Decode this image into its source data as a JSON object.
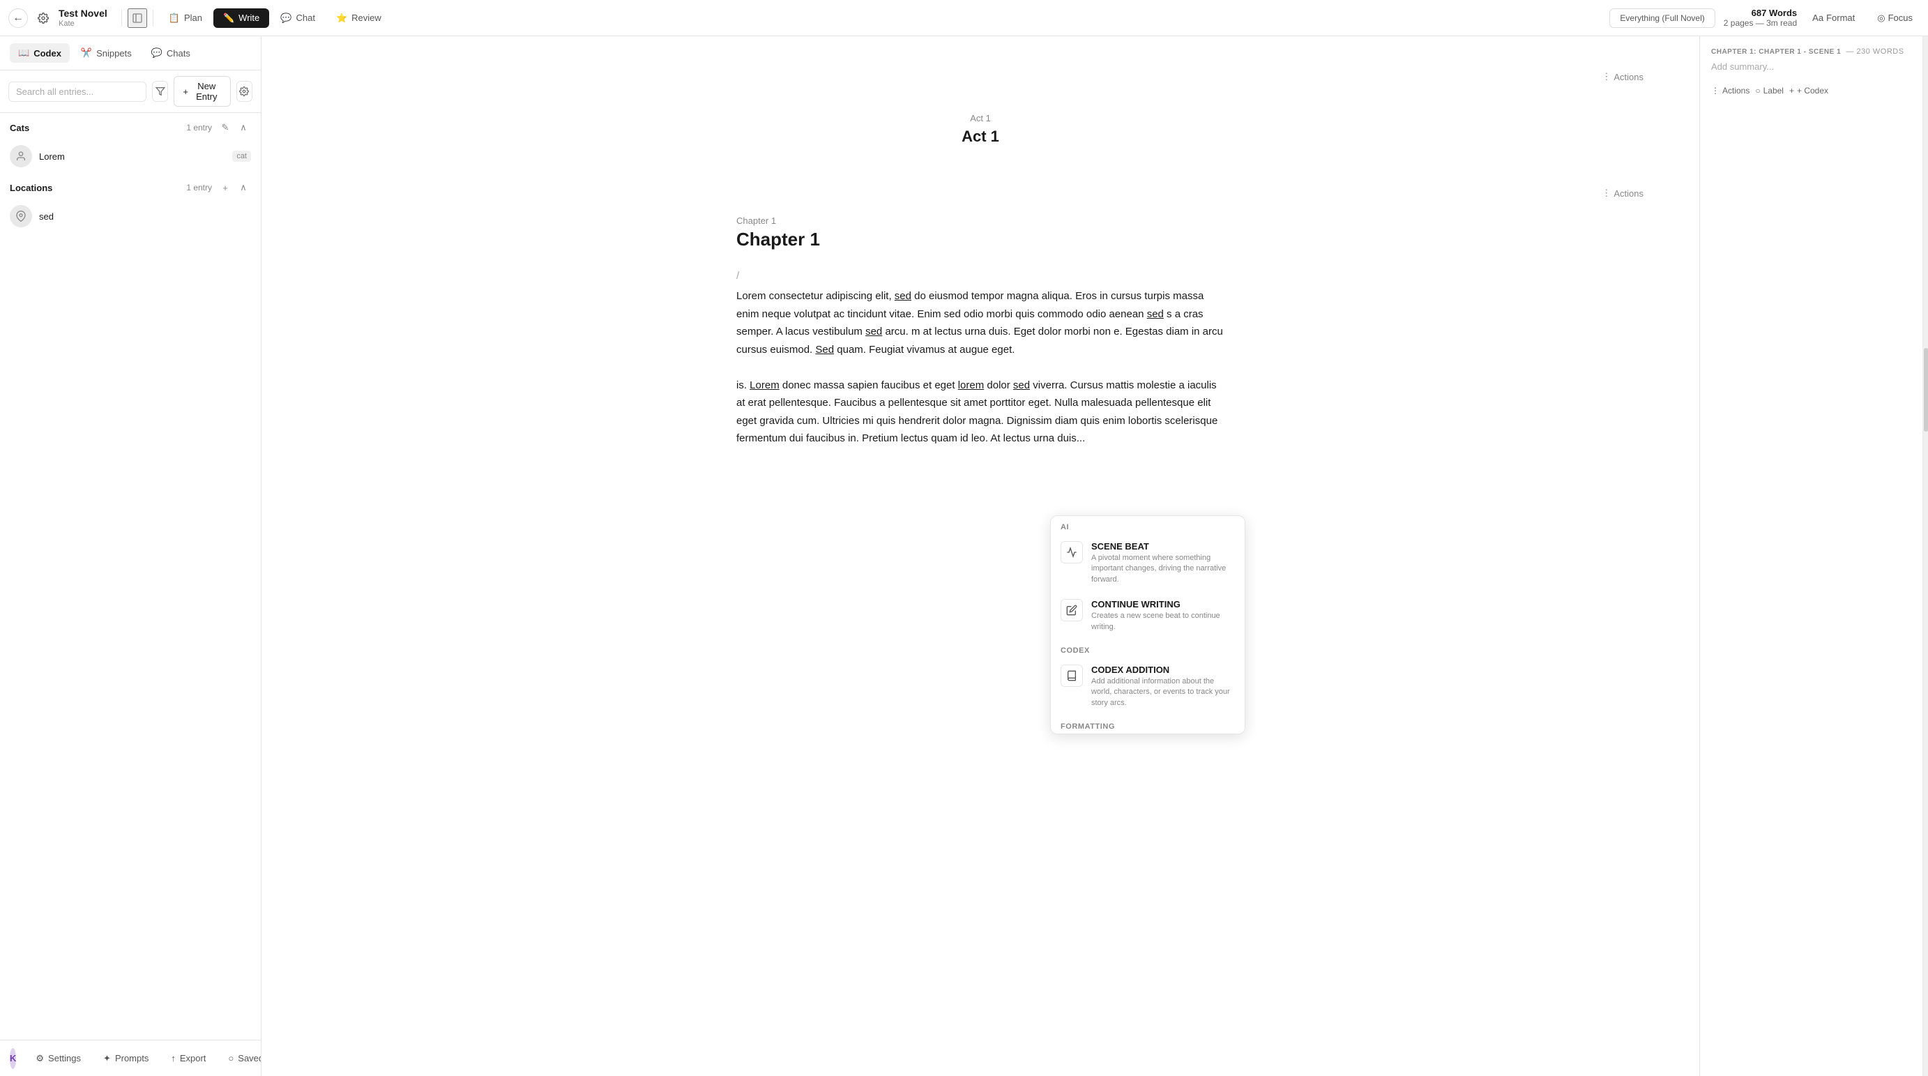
{
  "app": {
    "title": "Test Novel",
    "subtitle": "Kate",
    "back_label": "←",
    "settings_label": "⚙"
  },
  "top_nav": {
    "tabs": [
      {
        "id": "plan",
        "label": "Plan",
        "icon": "📋",
        "active": false
      },
      {
        "id": "write",
        "label": "Write",
        "icon": "✏️",
        "active": true
      },
      {
        "id": "chat",
        "label": "Chat",
        "icon": "💬",
        "active": false
      },
      {
        "id": "review",
        "label": "Review",
        "icon": "⭐",
        "active": false
      }
    ],
    "view_label": "Everything (Full Novel)",
    "word_count": "687 Words",
    "word_detail": "2 pages — 3m read",
    "format_label": "Format",
    "focus_label": "Focus"
  },
  "sidebar": {
    "tabs": [
      {
        "id": "codex",
        "label": "Codex",
        "active": true
      },
      {
        "id": "snippets",
        "label": "Snippets",
        "active": false
      },
      {
        "id": "chats",
        "label": "Chats",
        "active": false
      }
    ],
    "search_placeholder": "Search all entries...",
    "new_entry_label": "New Entry",
    "sections": [
      {
        "title": "Cats",
        "count": "1 entry",
        "items": [
          {
            "id": "lorem",
            "name": "Lorem",
            "badge": "cat",
            "type": "person"
          }
        ]
      },
      {
        "title": "Locations",
        "count": "1 entry",
        "items": [
          {
            "id": "sed",
            "name": "sed",
            "badge": "",
            "type": "location"
          }
        ]
      }
    ]
  },
  "bottom_bar": {
    "settings_label": "Settings",
    "prompts_label": "Prompts",
    "export_label": "Export",
    "saved_label": "Saved",
    "user_initials": "K"
  },
  "editor": {
    "act": {
      "label": "Act 1",
      "title": "Act 1"
    },
    "chapter": {
      "label": "Chapter 1",
      "title": "Chapter 1"
    },
    "scene_label": "CHAPTER 1: CHAPTER 1 - SCENE 1",
    "scene_word_count": "230 Words",
    "summary_placeholder": "Add summary...",
    "slash_char": "/",
    "body_text": "ctetur adipiscing elit, sed do eiusmod tempor magna aliqua. Eros in cursus turpis massa enim neque volutpat ac tincidunt vitae. Enim d odio morbi quis commodo odio aenean sed s a cras semper. A lacus vestibulum sed arcu. m at lectus urna duis. Eget dolor morbi non e. Egestas diam in arcu cursus euismod. Sed quam. Feugiat vivamus at augue eget.",
    "body_text2": "is. Lorem donec massa sapien faucibus et eget lorem dolor sed viverra. Cursus mattis molestie a iaculis at erat pellentesque. Faucibus a pellentesque sit amet porttitor eget. Nulla malesuada pellentesque elit eget gravida cum. Ultricies mi quis hendrerit dolor magna. Dignissim diam quis enim lobortis scelerisque fermentum dui faucibus in. Pretium lectus quam id leo. At lectus urna duis...",
    "actions_label": "Actions"
  },
  "popup": {
    "ai_section": "AI",
    "items": [
      {
        "id": "scene-beat",
        "title": "SCENE BEAT",
        "description": "A pivotal moment where something important changes, driving the narrative forward.",
        "icon": "〜"
      },
      {
        "id": "continue-writing",
        "title": "CONTINUE WRITING",
        "description": "Creates a new scene beat to continue writing.",
        "icon": "✏"
      }
    ],
    "codex_section": "Codex",
    "codex_items": [
      {
        "id": "codex-addition",
        "title": "CODEX ADDITION",
        "description": "Add additional information about the world, characters, or events to track your story arcs.",
        "icon": "📚"
      }
    ],
    "formatting_section": "Formatting"
  },
  "right_panel": {
    "chapter_label": "CHAPTER 1: CHAPTER 1 - SCENE 1",
    "word_count_label": "— 230 Words",
    "summary_placeholder": "Add summary...",
    "actions_label": "Actions",
    "label_label": "Label",
    "codex_label": "+ Codex"
  }
}
